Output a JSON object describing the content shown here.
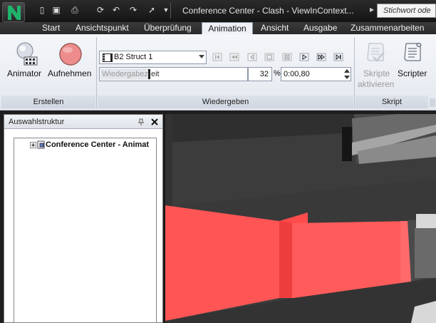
{
  "title": "Conference Center - Clash - ViewInContext...",
  "search_placeholder": "Stichwort ode",
  "tabs": [
    "Start",
    "Ansichtspunkt",
    "Überprüfung",
    "Animation",
    "Ansicht",
    "Ausgabe",
    "Zusammenarbeiten"
  ],
  "active_tab": "Animation",
  "ribbon": {
    "animator_label": "Animator",
    "record_label": "Aufnehmen",
    "animation_select": "B2 Struct 1",
    "slider_tooltip": "Wiedergabez",
    "slider_text": "eit",
    "percent_value": "32",
    "percent_unit": "%",
    "time_value": "0:00,80",
    "scripts_enable_line1": "Skripte",
    "scripts_enable_line2": "aktivieren",
    "scripter_label": "Scripter",
    "groups": {
      "create": "Erstellen",
      "playback": "Wiedergeben",
      "script": "Skript"
    }
  },
  "panel": {
    "title": "Auswahlstruktur",
    "tree_root": "Conference Center - Animat"
  },
  "colors": {
    "accent_red": "#ff5555",
    "titlebar": "#1f1f1f",
    "ribbon": "#eef1f5"
  }
}
